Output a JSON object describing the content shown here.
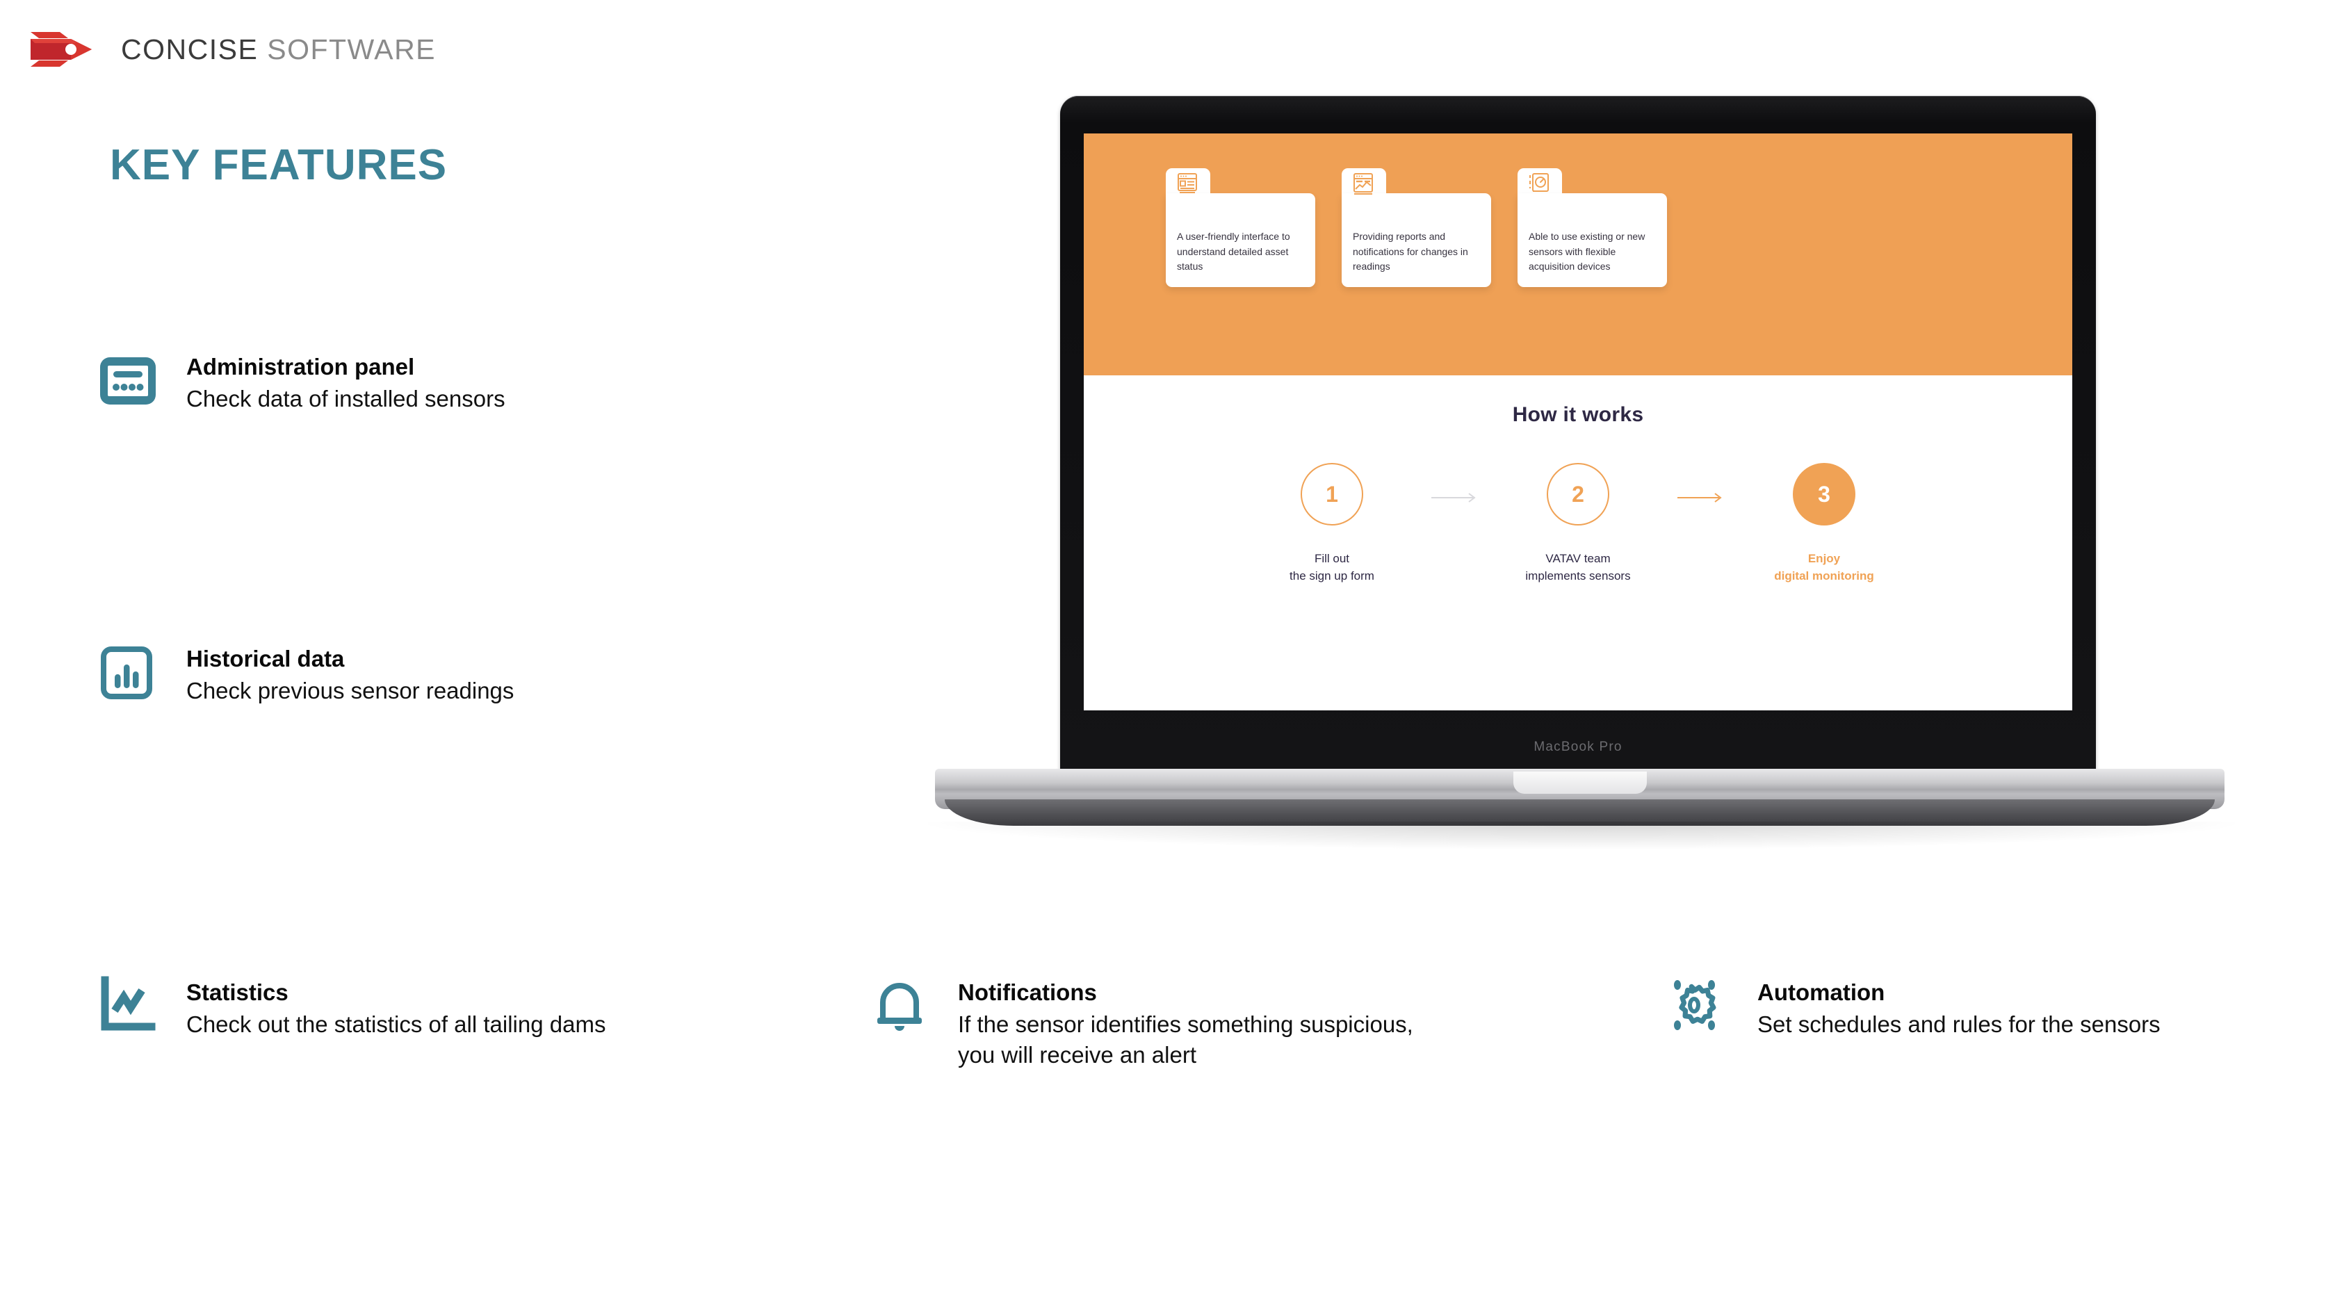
{
  "brand": {
    "logo_icon": "concise-arrow-logo",
    "name_bold": "CONCISE",
    "name_light": "SOFTWARE",
    "red": "#cf2027",
    "teal": "#3d8296",
    "orange": "#efa055",
    "navy": "#2e2844"
  },
  "page_title": "KEY FEATURES",
  "features": [
    {
      "id": "administration-panel",
      "icon": "admin-panel-icon",
      "title": "Administration panel",
      "desc": "Check data of installed sensors"
    },
    {
      "id": "historical-data",
      "icon": "bar-chart-icon",
      "title": "Historical data",
      "desc": "Check previous sensor readings"
    },
    {
      "id": "statistics",
      "icon": "line-chart-axes-icon",
      "title": "Statistics",
      "desc": "Check out the statistics of all tailing dams"
    },
    {
      "id": "notifications",
      "icon": "bell-icon",
      "title": "Notifications",
      "desc": "If the sensor identifies something suspicious, you will receive an alert"
    },
    {
      "id": "automation",
      "icon": "gear-icon",
      "title": "Automation",
      "desc": "Set schedules and rules for the sensors"
    }
  ],
  "laptop": {
    "model_label": "MacBook Pro",
    "screen": {
      "hero_cards": [
        {
          "icon": "browser-layout-icon",
          "text": "A user-friendly interface to understand detailed asset status"
        },
        {
          "icon": "report-chart-icon",
          "text": "Providing reports and notifications for changes in readings"
        },
        {
          "icon": "gauge-device-icon",
          "text": "Able to use existing or new sensors with flexible acquisition devices"
        }
      ],
      "how_it_works": {
        "title": "How it works",
        "steps": [
          {
            "number": "1",
            "label": "Fill out\nthe sign up form",
            "style": "outline"
          },
          {
            "number": "2",
            "label": "VATAV team\nimplements sensors",
            "style": "outline"
          },
          {
            "number": "3",
            "label": "Enjoy\ndigital monitoring",
            "style": "filled"
          }
        ],
        "arrows": [
          {
            "color": "#d8d8dc"
          },
          {
            "color": "#f0a255"
          }
        ]
      }
    }
  }
}
